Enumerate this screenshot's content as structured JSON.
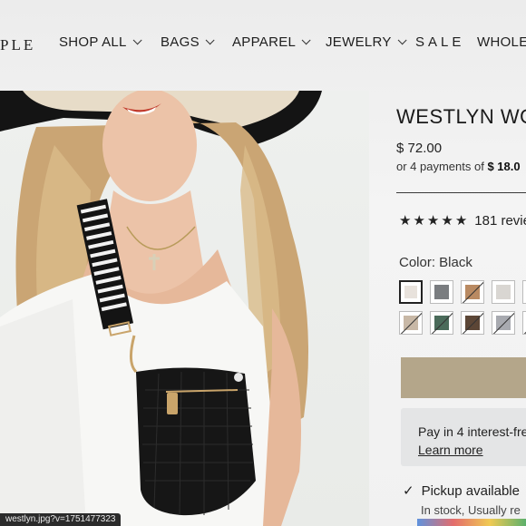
{
  "header": {
    "logo_text": "PLE",
    "nav": [
      {
        "label": "SHOP ALL"
      },
      {
        "label": "BAGS"
      },
      {
        "label": "APPAREL"
      },
      {
        "label": "JEWELRY"
      },
      {
        "label": "SALE"
      },
      {
        "label": "WHOLE"
      }
    ]
  },
  "product": {
    "image_filename": "westlyn.jpg?v=1751477323",
    "title": "WESTLYN WO",
    "price": "$ 72.00",
    "installments_prefix": "or 4 payments of",
    "installments_amount": "$ 18.0",
    "rating_stars": 5,
    "rating_count": "181 revie",
    "color_label": "Color: Black",
    "swatches": [
      {
        "color": "#e8e2dc",
        "sold_out": false,
        "selected": true
      },
      {
        "color": "#7a7d80",
        "sold_out": false,
        "selected": false
      },
      {
        "color": "#b98a62",
        "sold_out": true,
        "selected": false
      },
      {
        "color": "#d9d6d2",
        "sold_out": false,
        "selected": false
      },
      {
        "color": "#c9c3bb",
        "sold_out": false,
        "selected": false
      },
      {
        "color": "#c8b8a6",
        "sold_out": true,
        "selected": false
      },
      {
        "color": "#4a6b5a",
        "sold_out": true,
        "selected": false
      },
      {
        "color": "#5c4636",
        "sold_out": true,
        "selected": false
      },
      {
        "color": "#a8aab0",
        "sold_out": true,
        "selected": false
      },
      {
        "color": "#6a4434",
        "sold_out": true,
        "selected": false
      }
    ],
    "add_button_color": "#b4a68a",
    "pay_in_4_text": "Pay in 4 interest-fre",
    "learn_more": "Learn more",
    "pickup_text": "Pickup available",
    "stock_text": "In stock, Usually re"
  }
}
